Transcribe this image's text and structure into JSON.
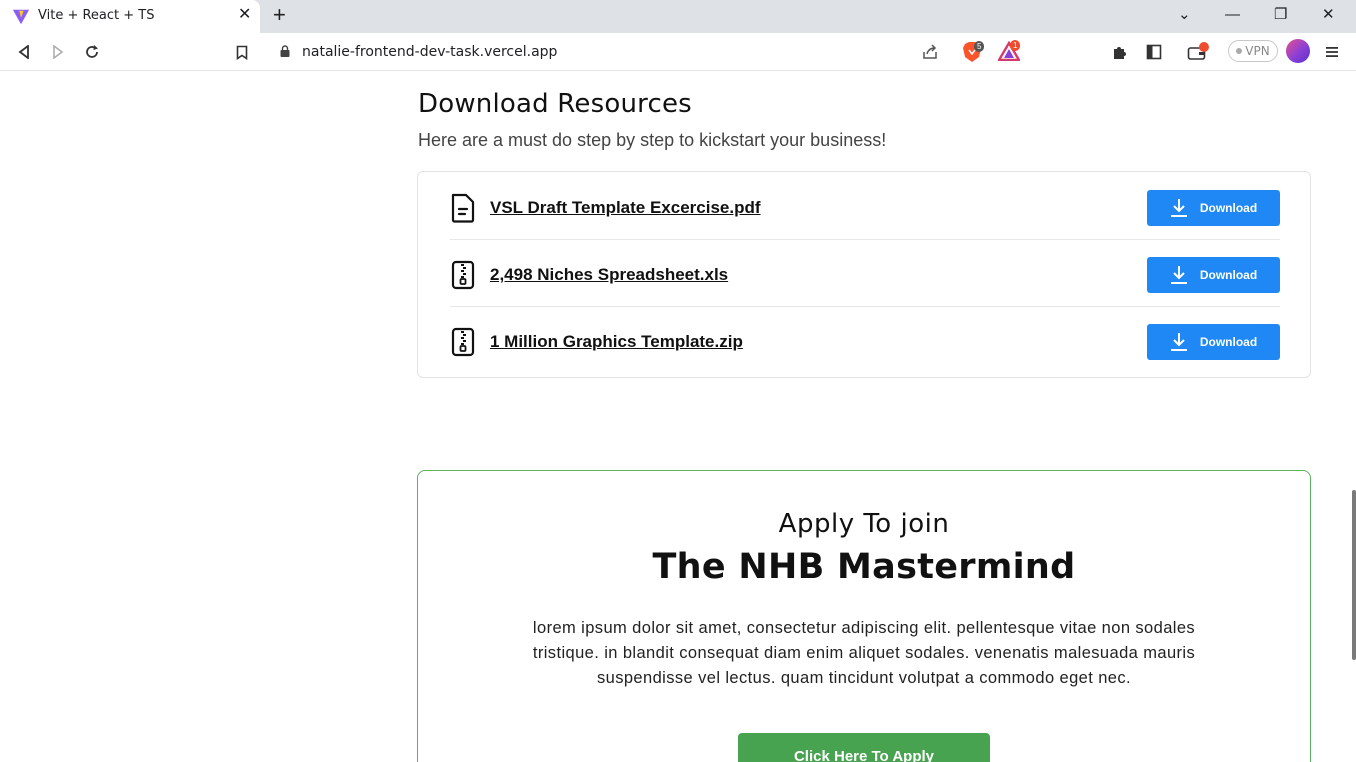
{
  "browser": {
    "tab_title": "Vite + React + TS",
    "tab_close": "✕",
    "new_tab": "+",
    "url": "natalie-frontend-dev-task.vercel.app",
    "brave_shield_count": "5",
    "brave_rewards_count": "1",
    "vpn_label": "VPN",
    "window_controls": {
      "tab_search": "⌄",
      "minimize": "—",
      "restore": "❐",
      "close": "✕"
    }
  },
  "downloads": {
    "title": "Download Resources",
    "subtitle": "Here are a must do step by step to kickstart your business!",
    "items": [
      {
        "name": "VSL Draft Template Excercise.pdf",
        "icon": "document-icon",
        "button": "Download"
      },
      {
        "name": "2,498 Niches Spreadsheet.xls",
        "icon": "zip-file-icon",
        "button": "Download"
      },
      {
        "name": "1 Million Graphics Template.zip",
        "icon": "zip-file-icon",
        "button": "Download"
      }
    ]
  },
  "apply": {
    "eyebrow": "Apply To join",
    "title": "The NHB Mastermind",
    "body": "lorem ipsum dolor sit amet, consectetur adipiscing elit. pellentesque vitae non sodales tristique. in blandit consequat diam enim aliquet sodales. venenatis malesuada mauris suspendisse vel lectus. quam tincidunt volutpat a commodo eget nec.",
    "button": "Click Here To Apply"
  },
  "colors": {
    "download_button": "#1f88f5",
    "apply_button": "#47a34f",
    "apply_border": "#5cb25c"
  }
}
